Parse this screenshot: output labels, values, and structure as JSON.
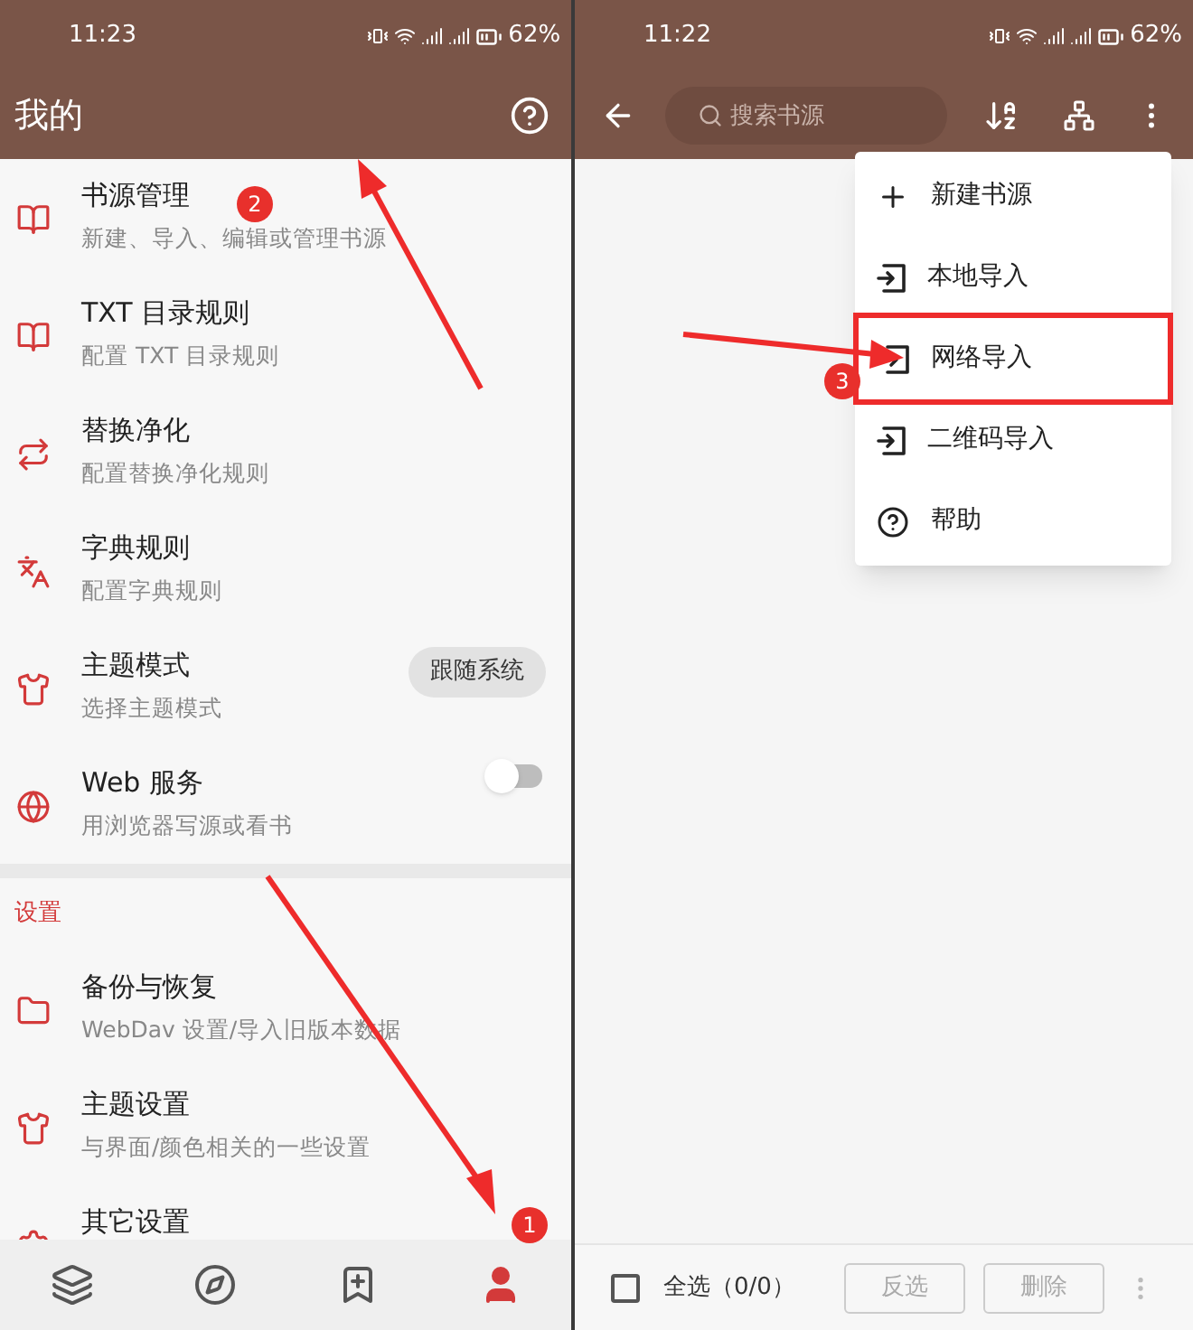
{
  "left": {
    "status_bar": {
      "time": "11:23",
      "battery": "62%"
    },
    "header": {
      "title": "我的"
    },
    "items": [
      {
        "kind": "text",
        "title": "书源管理",
        "subtitle": "新建、导入、编辑或管理书源"
      },
      {
        "kind": "text",
        "title": "TXT 目录规则",
        "subtitle": "配置 TXT 目录规则"
      },
      {
        "kind": "text",
        "title": "替换净化",
        "subtitle": "配置替换净化规则"
      },
      {
        "kind": "text",
        "title": "字典规则",
        "subtitle": "配置字典规则"
      },
      {
        "kind": "choice",
        "title": "主题模式",
        "subtitle": "选择主题模式",
        "value": "跟随系统"
      },
      {
        "kind": "switch",
        "title": "Web 服务",
        "subtitle": "用浏览器写源或看书",
        "on": false
      }
    ],
    "section": {
      "title": "设置",
      "items": [
        {
          "title": "备份与恢复",
          "subtitle": "WebDav 设置/导入旧版本数据"
        },
        {
          "title": "主题设置",
          "subtitle": "与界面/颜色相关的一些设置"
        },
        {
          "title": "其它设置"
        }
      ]
    },
    "bottom_nav": [
      {
        "selected": false
      },
      {
        "selected": false
      },
      {
        "selected": false
      },
      {
        "selected": true
      }
    ]
  },
  "right": {
    "status_bar": {
      "time": "11:22",
      "battery": "62%"
    },
    "search": {
      "placeholder": "搜索书源"
    },
    "menu": [
      {
        "label": "新建书源",
        "highlighted": false
      },
      {
        "label": "本地导入",
        "highlighted": false
      },
      {
        "label": "网络导入",
        "highlighted": true
      },
      {
        "label": "二维码导入",
        "highlighted": false
      },
      {
        "label": "帮助",
        "highlighted": false
      }
    ],
    "bottom_bar": {
      "select_all": {
        "label": "全选（0/0）",
        "checked": false
      },
      "buttons": [
        {
          "label": "反选",
          "disabled": true
        },
        {
          "label": "删除",
          "disabled": true
        }
      ]
    }
  },
  "annotations": [
    "1",
    "2",
    "3"
  ]
}
